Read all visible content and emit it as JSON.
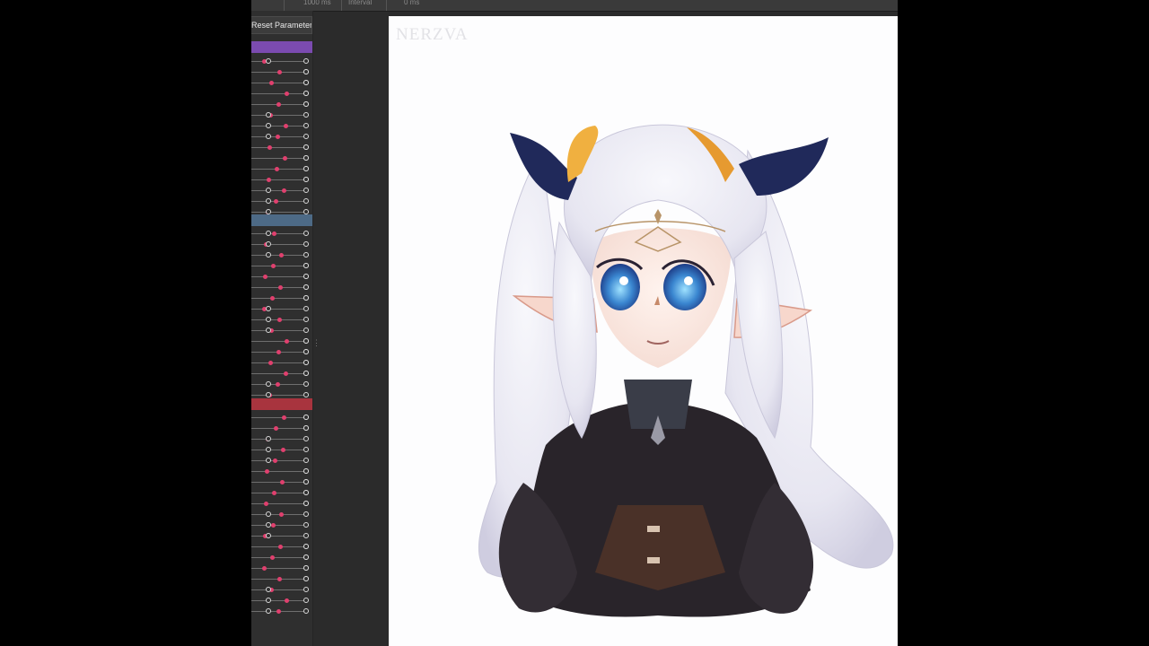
{
  "toolbar": {
    "items": [
      "1000 ms",
      "Interval",
      "0 ms"
    ]
  },
  "panel": {
    "reset_label": "Reset Parameter to Default",
    "groups": [
      {
        "color": "#7b4bb0",
        "slider_count": 15
      },
      {
        "color": "#4d6a86",
        "slider_count": 16
      },
      {
        "color": "#a8343e",
        "slider_count": 19
      }
    ]
  },
  "canvas": {
    "watermark": "NERZVA",
    "background": "#fdfdfe"
  },
  "colors": {
    "keyframe": "#e0406e",
    "panel_bg": "#2f2f2f",
    "workspace_bg": "#2b2b2b"
  }
}
